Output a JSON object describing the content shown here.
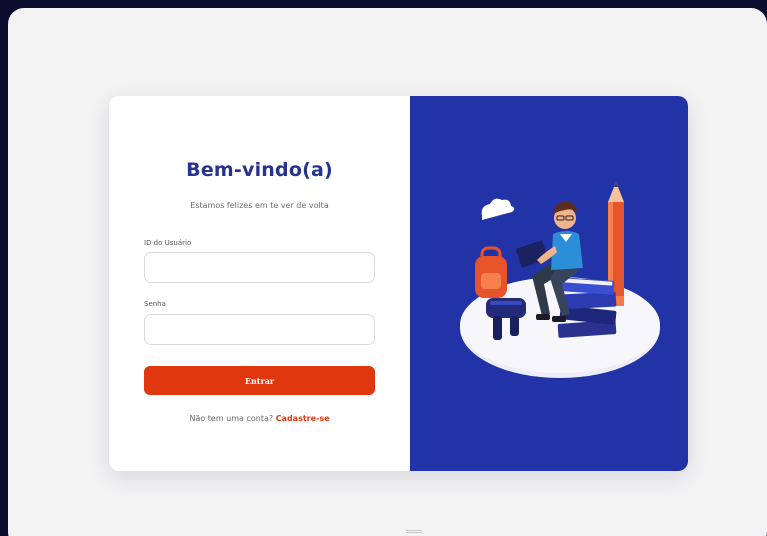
{
  "login": {
    "title": "Bem-vindo(a)",
    "subtitle": "Estamos felizes em te ver de volta",
    "user_id_label": "ID do Usuário",
    "user_id_value": "",
    "password_label": "Senha",
    "password_value": "",
    "submit_label": "Entrar",
    "signup_prompt": "Não tem uma conta?",
    "signup_link": "Cadastre-se"
  },
  "colors": {
    "accent": "#e0370f",
    "brand_blue": "#2233a8",
    "title_blue": "#26338f"
  },
  "icons": {
    "illustration": "student-reading-illustration"
  }
}
